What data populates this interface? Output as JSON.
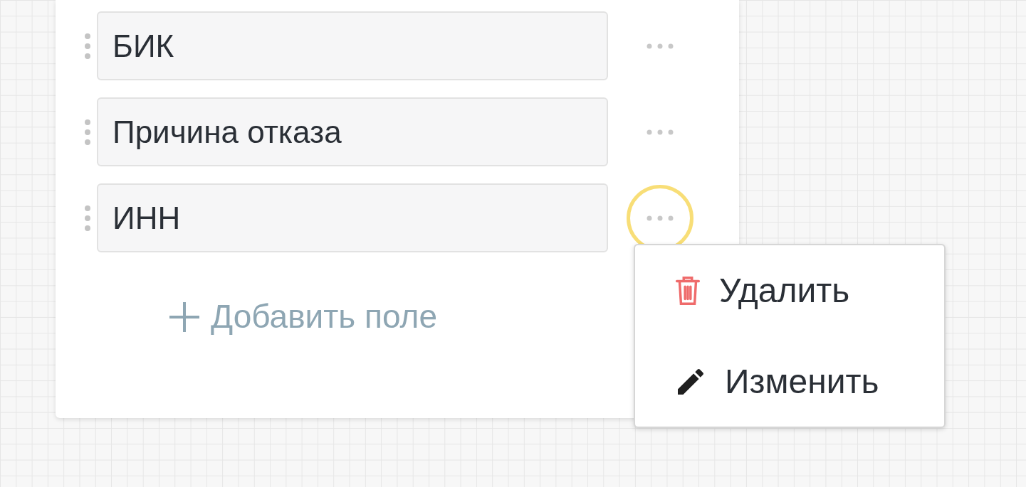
{
  "fields": [
    {
      "label": "БИК",
      "highlighted": false
    },
    {
      "label": "Причина отказа",
      "highlighted": false
    },
    {
      "label": "ИНН",
      "highlighted": true
    }
  ],
  "add_button": {
    "label": "Добавить поле"
  },
  "context_menu": {
    "items": [
      {
        "kind": "delete",
        "label": "Удалить"
      },
      {
        "kind": "edit",
        "label": "Изменить"
      }
    ]
  }
}
